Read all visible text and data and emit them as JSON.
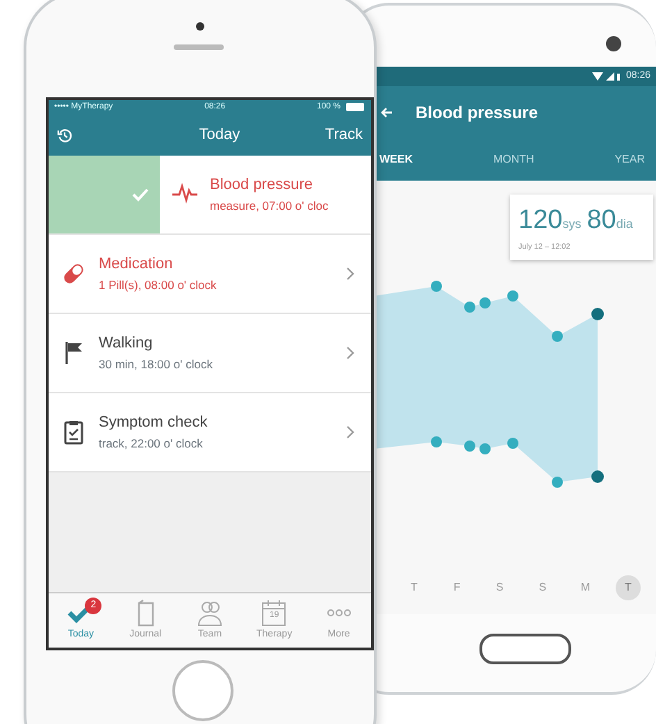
{
  "android_phone": {
    "status_bar": {
      "time": "08:26"
    },
    "toolbar": {
      "title": "Blood pressure"
    },
    "tabs": [
      {
        "label": "WEEK",
        "selected": true
      },
      {
        "label": "MONTH",
        "selected": false
      },
      {
        "label": "YEAR",
        "selected": false
      }
    ],
    "reading": {
      "systolic": "120",
      "systolic_unit": "sys",
      "diastolic": "80",
      "diastolic_unit": "dia",
      "date": "July 12 – 12:02"
    },
    "days": [
      {
        "label": "T",
        "selected": false
      },
      {
        "label": "F",
        "selected": false
      },
      {
        "label": "S",
        "selected": false
      },
      {
        "label": "S",
        "selected": false
      },
      {
        "label": "M",
        "selected": false
      },
      {
        "label": "T",
        "selected": true
      }
    ]
  },
  "ios_phone": {
    "status_bar": {
      "carrier": "••••• MyTherapy",
      "time": "08:26",
      "battery": "100 %"
    },
    "nav_bar": {
      "title": "Today",
      "action": "Track"
    },
    "tasks": [
      {
        "kind": "measurement",
        "title": "Blood pressure",
        "detail": "measure, 07:00 o' cloc",
        "done": true
      },
      {
        "kind": "medication",
        "title": "Medication",
        "detail": "1 Pill(s), 08:00 o' clock",
        "done": false
      },
      {
        "kind": "activity",
        "title": "Walking",
        "detail": "30 min, 18:00 o' clock",
        "done": false
      },
      {
        "kind": "symptom",
        "title": "Symptom check",
        "detail": "track, 22:00 o' clock",
        "done": false
      }
    ],
    "tab_bar": [
      {
        "kind": "today",
        "label": "Today",
        "selected": true,
        "badge": "2"
      },
      {
        "kind": "journal",
        "label": "Journal",
        "selected": false
      },
      {
        "kind": "team",
        "label": "Team",
        "selected": false
      },
      {
        "kind": "therapy",
        "label": "Therapy",
        "selected": false,
        "icon_text": "19"
      },
      {
        "kind": "more",
        "label": "More",
        "selected": false
      }
    ]
  }
}
